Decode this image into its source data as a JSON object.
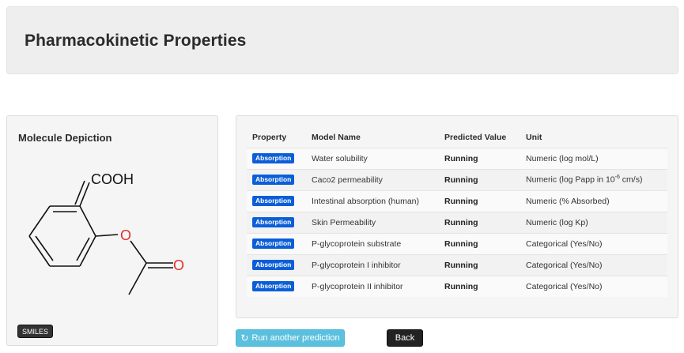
{
  "header": {
    "title": "Pharmacokinetic Properties"
  },
  "molecule_panel": {
    "title": "Molecule Depiction",
    "labels": {
      "cooh": "COOH",
      "ester_o": "O",
      "carbonyl_o": "O"
    },
    "smiles_label": "SMILES",
    "colors": {
      "bond": "#111111",
      "oxygen": "#e0302a"
    }
  },
  "table": {
    "headers": [
      "Property",
      "Model Name",
      "Predicted Value",
      "Unit"
    ],
    "rows": [
      {
        "property": "Absorption",
        "model": "Water solubility",
        "value": "Running",
        "unit": "Numeric (log mol/L)"
      },
      {
        "property": "Absorption",
        "model": "Caco2 permeability",
        "value": "Running",
        "unit_prefix": "Numeric (log Papp in 10",
        "unit_sup": "-6",
        "unit_suffix": " cm/s)"
      },
      {
        "property": "Absorption",
        "model": "Intestinal absorption (human)",
        "value": "Running",
        "unit": "Numeric (% Absorbed)"
      },
      {
        "property": "Absorption",
        "model": "Skin Permeability",
        "value": "Running",
        "unit": "Numeric (log Kp)"
      },
      {
        "property": "Absorption",
        "model": "P-glycoprotein substrate",
        "value": "Running",
        "unit": "Categorical (Yes/No)"
      },
      {
        "property": "Absorption",
        "model": "P-glycoprotein I inhibitor",
        "value": "Running",
        "unit": "Categorical (Yes/No)"
      },
      {
        "property": "Absorption",
        "model": "P-glycoprotein II inhibitor",
        "value": "Running",
        "unit": "Categorical (Yes/No)"
      }
    ],
    "badge_color": "#0b5ed7"
  },
  "actions": {
    "run_label": "Run another prediction",
    "back_label": "Back",
    "run_icon": "refresh-icon"
  }
}
